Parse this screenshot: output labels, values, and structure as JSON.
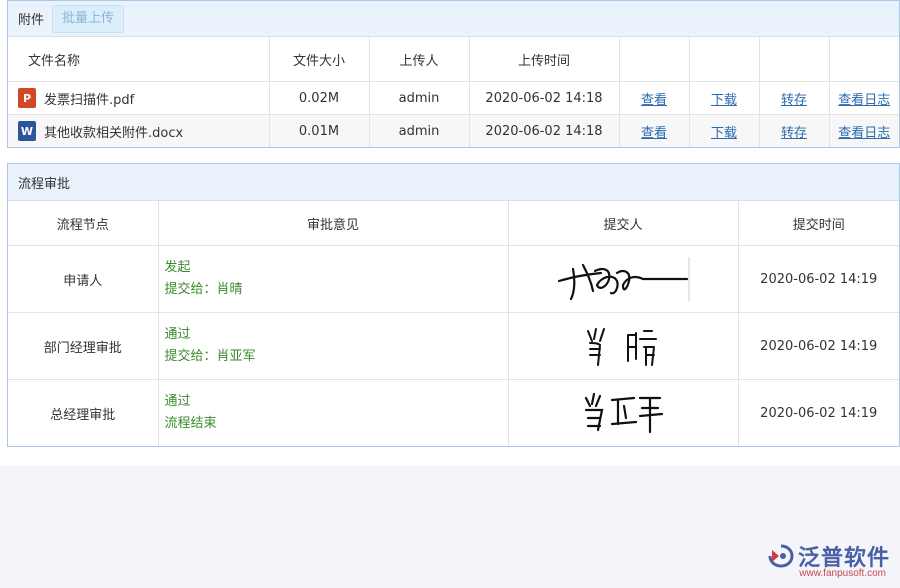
{
  "attachments": {
    "title": "附件",
    "batch_upload": "批量上传",
    "columns": [
      "文件名称",
      "文件大小",
      "上传人",
      "上传时间"
    ],
    "files": [
      {
        "icon": "pdf-file-icon",
        "icon_letter": "P",
        "name": "发票扫描件.pdf",
        "size": "0.02M",
        "uploader": "admin",
        "time": "2020-06-02 14:18"
      },
      {
        "icon": "word-file-icon",
        "icon_letter": "W",
        "name": "其他收款相关附件.docx",
        "size": "0.01M",
        "uploader": "admin",
        "time": "2020-06-02 14:18"
      }
    ],
    "actions": {
      "view": "查看",
      "download": "下载",
      "transfer": "转存",
      "log": "查看日志"
    }
  },
  "approval": {
    "title": "流程审批",
    "columns": [
      "流程节点",
      "审批意见",
      "提交人",
      "提交时间"
    ],
    "rows": [
      {
        "node": "申请人",
        "opinion": "发起",
        "next": "提交给：肖晴",
        "time": "2020-06-02 14:19"
      },
      {
        "node": "部门经理审批",
        "opinion": "通过",
        "next": "提交给：肖亚军",
        "time": "2020-06-02 14:19"
      },
      {
        "node": "总经理审批",
        "opinion": "通过",
        "next": "流程结束",
        "time": "2020-06-02 14:19"
      }
    ]
  },
  "brand": {
    "name": "泛普软件",
    "url": "www.fanpusoft.com",
    "color": "#4a5fa5"
  }
}
